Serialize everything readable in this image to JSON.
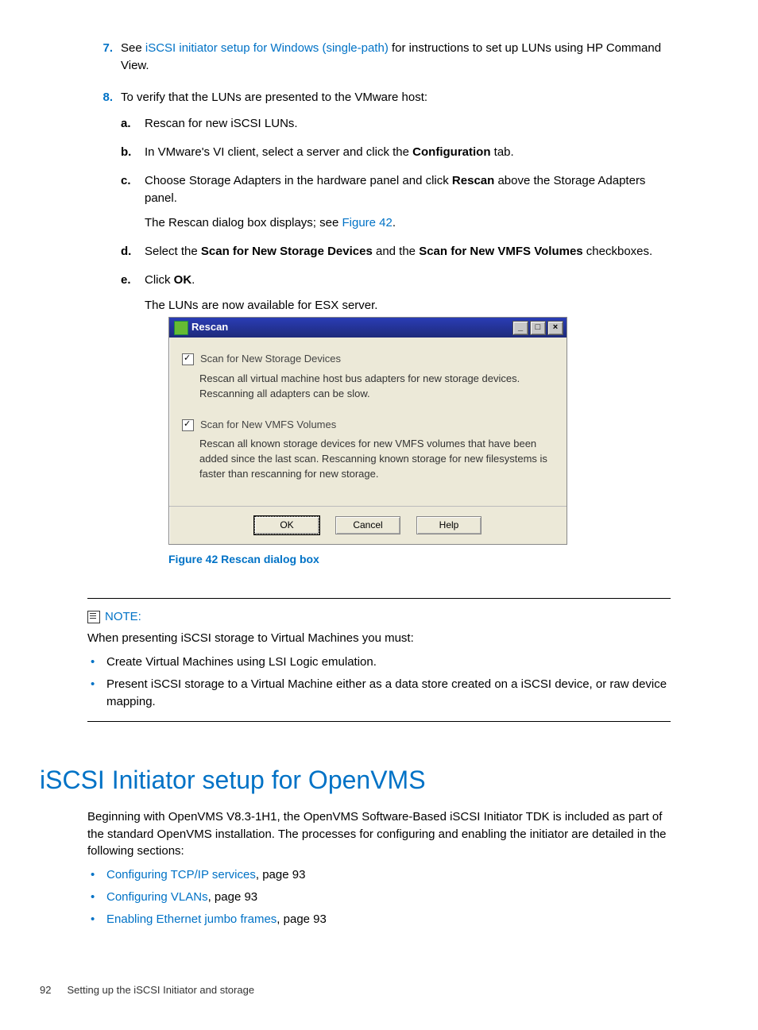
{
  "steps": {
    "s7": {
      "num": "7.",
      "text_a": "See ",
      "link": "iSCSI initiator setup for Windows (single-path)",
      "text_b": " for instructions to set up LUNs using HP Command View."
    },
    "s8": {
      "num": "8.",
      "intro": "To verify that the LUNs are presented to the VMware host:",
      "a": {
        "m": "a.",
        "text": "Rescan for new iSCSI LUNs."
      },
      "b": {
        "m": "b.",
        "pre": "In VMware's VI client, select a server and click the ",
        "bold": "Configuration",
        "post": " tab."
      },
      "c": {
        "m": "c.",
        "pre": "Choose Storage Adapters in the hardware panel and click ",
        "bold": "Rescan",
        "post": " above the Storage Adapters panel.",
        "extra_pre": "The Rescan dialog box displays; see ",
        "extra_link": "Figure 42",
        "extra_post": "."
      },
      "d": {
        "m": "d.",
        "pre": "Select the ",
        "b1": "Scan for New Storage Devices",
        "mid": " and the ",
        "b2": "Scan for New VMFS Volumes",
        "post": " checkboxes."
      },
      "e": {
        "m": "e.",
        "pre": "Click ",
        "bold": "OK",
        "post": ".",
        "extra": "The LUNs are now available for ESX server."
      }
    }
  },
  "dialog": {
    "title": "Rescan",
    "opt1": {
      "label": "Scan for New Storage Devices",
      "desc": "Rescan all virtual machine host bus adapters for new storage devices.  Rescanning all adapters can be slow."
    },
    "opt2": {
      "label": "Scan for New VMFS Volumes",
      "desc": "Rescan all known storage devices for new VMFS volumes that have been added since the last scan. Rescanning known storage for new filesystems is faster than rescanning for new storage."
    },
    "btn_ok": "OK",
    "btn_cancel": "Cancel",
    "btn_help": "Help"
  },
  "figure_caption": "Figure 42 Rescan dialog box",
  "note": {
    "label": "NOTE:",
    "intro": "When presenting iSCSI storage to Virtual Machines you must:",
    "b1": "Create Virtual Machines using LSI Logic emulation.",
    "b2": "Present iSCSI storage to a Virtual Machine either as a data store created on a iSCSI device, or raw device mapping."
  },
  "section": {
    "title": "iSCSI Initiator setup for OpenVMS",
    "para": "Beginning with OpenVMS V8.3-1H1, the OpenVMS Software-Based iSCSI Initiator TDK is included as part of the standard OpenVMS installation. The processes for configuring and enabling the initiator are detailed in the following sections:",
    "l1": {
      "link": "Configuring TCP/IP services",
      "rest": ", page 93"
    },
    "l2": {
      "link": "Configuring VLANs",
      "rest": ", page 93"
    },
    "l3": {
      "link": "Enabling Ethernet jumbo frames",
      "rest": ", page 93"
    }
  },
  "footer": {
    "page": "92",
    "chapter": "Setting up the iSCSI Initiator and storage"
  }
}
